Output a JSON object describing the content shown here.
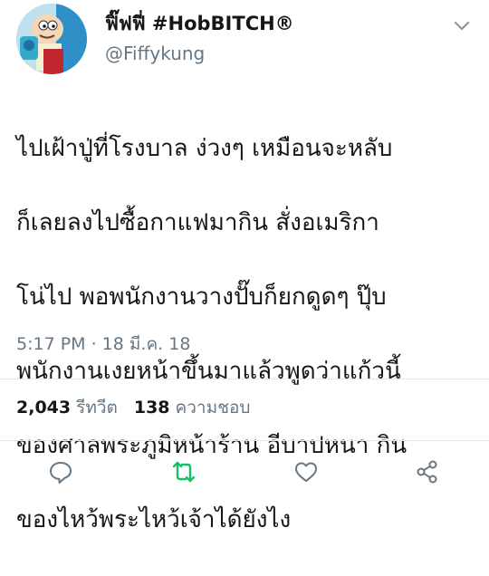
{
  "tweet": {
    "display_name": "ฟิ๊ฟฟี่ #HobBITCH®",
    "handle": "@Fiffykung",
    "text_lines": [
      "ไปเฝ้าปู่ที่โรงบาล ง่วงๆ เหมือนจะหลับ",
      "ก็เลยลงไปซื้อกาแฟมากิน สั่งอเมริกา",
      "โน่ไป พอพนักงานวางปั๊บก็ยกดูดๆ ปุ๊บ",
      "พนักงานเงยหน้าขึ้นมาแล้วพูดว่าแก้วนี้",
      "ของศาลพระภูมิหน้าร้าน อีบาปหนา กิน",
      "ของไหว้พระไหว้เจ้าได้ยังไง"
    ],
    "timestamp": "5:17 PM · 18 มี.ค. 18"
  },
  "stats": {
    "retweets_count": "2,043",
    "retweets_label": "รีทวีต",
    "likes_count": "138",
    "likes_label": "ความชอบ"
  },
  "icons": {
    "more": "chevron-down-icon",
    "reply": "reply-icon",
    "retweet": "retweet-icon",
    "like": "heart-icon",
    "share": "share-icon"
  },
  "colors": {
    "text_primary": "#14171a",
    "text_secondary": "#657786",
    "icon_default": "#657786",
    "retweet_active": "#17bf63",
    "divider": "#e1e8ed"
  }
}
